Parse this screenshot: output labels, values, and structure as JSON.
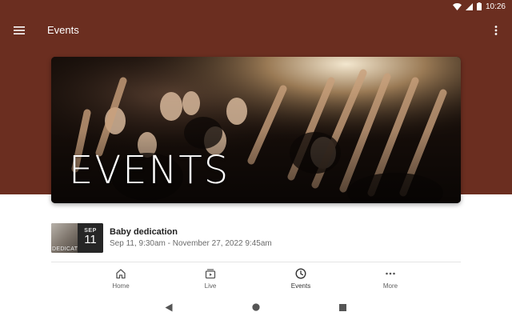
{
  "status_bar": {
    "time": "10:26"
  },
  "app_bar": {
    "title": "Events"
  },
  "banner": {
    "text": "EVENTS"
  },
  "events": [
    {
      "title": "Baby dedication",
      "date_range": "Sep 11, 9:30am - November 27, 2022 9:45am",
      "thumb_month": "SEP",
      "thumb_day": "11",
      "thumb_caption": "DEDICAT"
    }
  ],
  "bottom_nav": {
    "items": [
      {
        "label": "Home",
        "icon": "home-icon"
      },
      {
        "label": "Live",
        "icon": "live-icon"
      },
      {
        "label": "Events",
        "icon": "clock-icon",
        "active": true
      },
      {
        "label": "More",
        "icon": "more-horizontal-icon"
      }
    ]
  },
  "colors": {
    "header": "#6b2e20",
    "background": "#ffffff",
    "nav_label": "#5f5f5f"
  }
}
